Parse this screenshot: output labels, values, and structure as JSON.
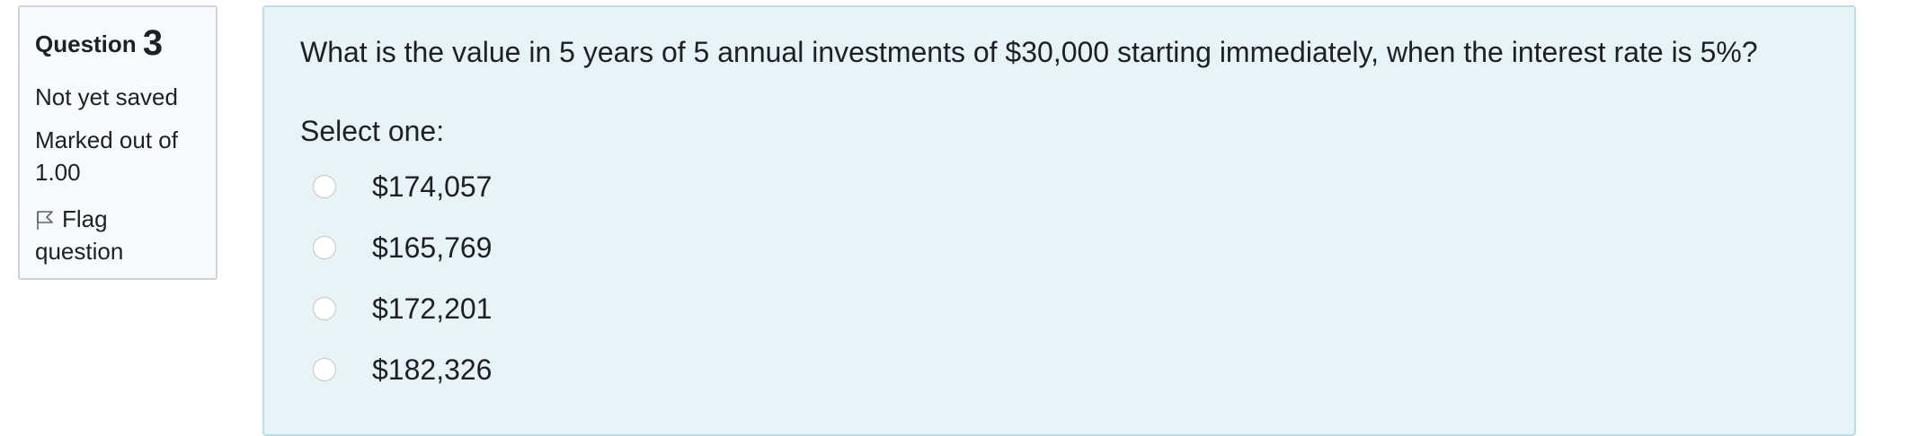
{
  "info": {
    "question_label": "Question",
    "question_number": "3",
    "state": "Not yet saved",
    "marked_out_of_label": "Marked out of",
    "marked_out_of_value": "1.00",
    "flag_label": "Flag",
    "flag_label_2": "question",
    "flag_icon": "flag-icon"
  },
  "question": {
    "text": "What is the value in 5 years of 5 annual investments of $30,000 starting immediately, when the interest rate is 5%?",
    "prompt": "Select one:",
    "answers": [
      {
        "label": "$174,057",
        "selected": false
      },
      {
        "label": "$165,769",
        "selected": false
      },
      {
        "label": "$172,201",
        "selected": false
      },
      {
        "label": "$182,326",
        "selected": false
      }
    ]
  },
  "colors": {
    "info_background": "#f8f9fa",
    "content_background": "#e7f3f5",
    "content_border": "#b8dde4"
  }
}
